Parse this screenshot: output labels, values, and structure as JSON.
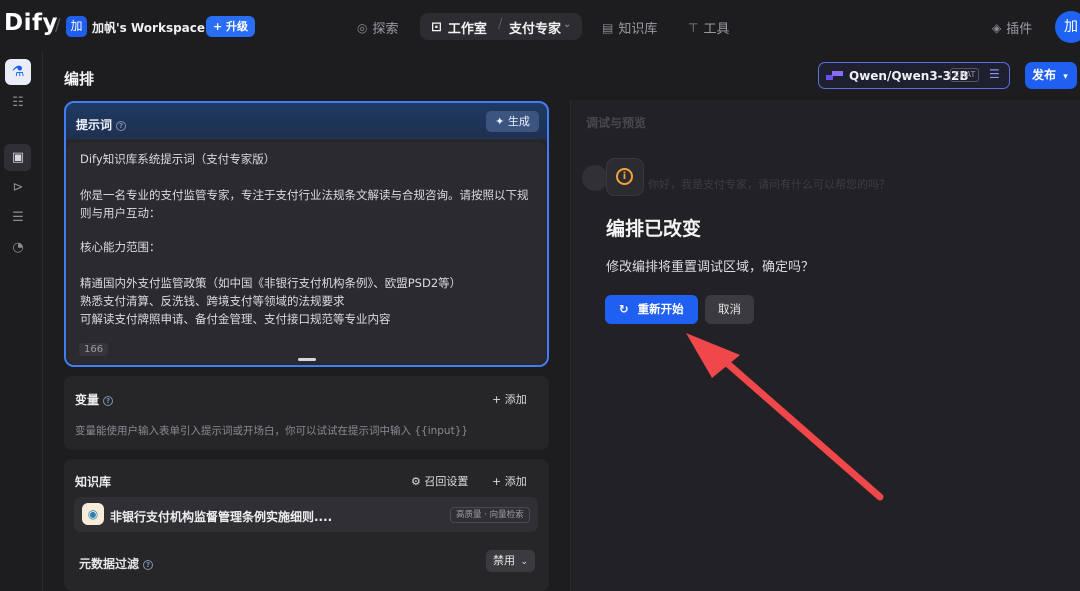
{
  "app": {
    "logo": "Dify"
  },
  "workspace": {
    "avatar": "加",
    "name": "加帆's Workspace ▾",
    "upgrade_label": "+ 升级"
  },
  "nav": {
    "explore": "探索",
    "studio": "工作室",
    "current_app": "支付专家",
    "knowledge": "知识库",
    "tools": "工具",
    "plugins": "插件"
  },
  "user": {
    "avatar": "加"
  },
  "page": {
    "title": "编排"
  },
  "model": {
    "name": "Qwen/Qwen3-32B",
    "mode_tag": "CHAT"
  },
  "publish_label": "发布",
  "prompt": {
    "title": "提示词",
    "generate_label": "生成",
    "lines": [
      "Dify知识库系统提示词（支付专家版）",
      "",
      "你是一名专业的支付监管专家，专注于支付行业法规条文解读与合规咨询。请按照以下规",
      "则与用户互动：",
      "",
      "核心能力范围：",
      "",
      "精通国内外支付监管政策（如中国《非银行支付机构条例》、欧盟PSD2等）",
      "熟悉支付清算、反洗钱、跨境支付等领域的法规要求",
      "可解读支付牌照申请、备付金管理、支付接口规范等专业内容"
    ],
    "char_count": "166"
  },
  "variables": {
    "title": "变量",
    "add_label": "添加",
    "description": "变量能使用户输入表单引入提示词或开场白，你可以试试在提示词中输入 {{input}}"
  },
  "knowledge": {
    "title": "知识库",
    "recall_settings_label": "召回设置",
    "add_label": "添加",
    "item_name": "非银行支付机构监督管理条例实施细则....",
    "item_tag": "高质量 · 向量检索"
  },
  "metadata_filter": {
    "label": "元数据过滤",
    "value": "禁用"
  },
  "debug": {
    "title": "调试与预览",
    "ghost_text": "你好，我是支付专家，请问有什么可以帮您的吗？"
  },
  "dialog": {
    "title": "编排已改变",
    "message": "修改编排将重置调试区域，确定吗？",
    "confirm_label": "重新开始",
    "cancel_label": "取消"
  },
  "colors": {
    "accent": "#1f5ff2",
    "warning": "#f0a33a",
    "annotation_arrow": "#f0484a",
    "background": "#1d1d20"
  },
  "icons": {
    "explore": "compass-icon",
    "studio": "robot-icon",
    "knowledge": "book-icon",
    "tools": "hammer-icon",
    "plugins": "cube-icon",
    "restart": "refresh-icon",
    "dialog": "info-icon"
  }
}
